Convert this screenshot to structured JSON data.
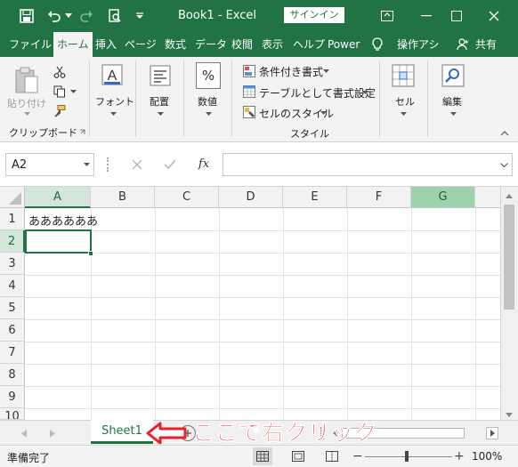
{
  "titlebar": {
    "title": "Book1 - Excel",
    "signin_label": "サインイン"
  },
  "tabs": [
    "ファイル",
    "ホーム",
    "挿入",
    "ページ",
    "数式",
    "データ",
    "校閲",
    "表示",
    "ヘルプ",
    "Power"
  ],
  "tabs_active_index": 1,
  "tell_me_label": "操作アシ",
  "share_label": "共有",
  "ribbon": {
    "paste_label": "貼り付け",
    "clipboard_group": "クリップボード",
    "font_label": "フォント",
    "align_label": "配置",
    "number_label": "数値",
    "number_symbol": "%",
    "cond_format_label": "条件付き書式",
    "table_format_label": "テーブルとして書式設定",
    "cell_style_label": "セルのスタイル",
    "style_group": "スタイル",
    "cells_label": "セル",
    "edit_label": "編集"
  },
  "formula_bar": {
    "name_box": "A2",
    "fx": "fx",
    "value": ""
  },
  "grid": {
    "columns": [
      "A",
      "B",
      "C",
      "D",
      "E",
      "F",
      "G"
    ],
    "rows": [
      "1",
      "2",
      "3",
      "4",
      "5",
      "6",
      "7",
      "8",
      "9",
      "10"
    ],
    "cell_A1": "ああああああ"
  },
  "sheet_tab": "Sheet1",
  "annotation": "ここで右クリック",
  "status": {
    "ready": "準備完了",
    "zoom": "100%"
  },
  "colors": {
    "accent": "#217346",
    "annotation": "#e8202a"
  }
}
